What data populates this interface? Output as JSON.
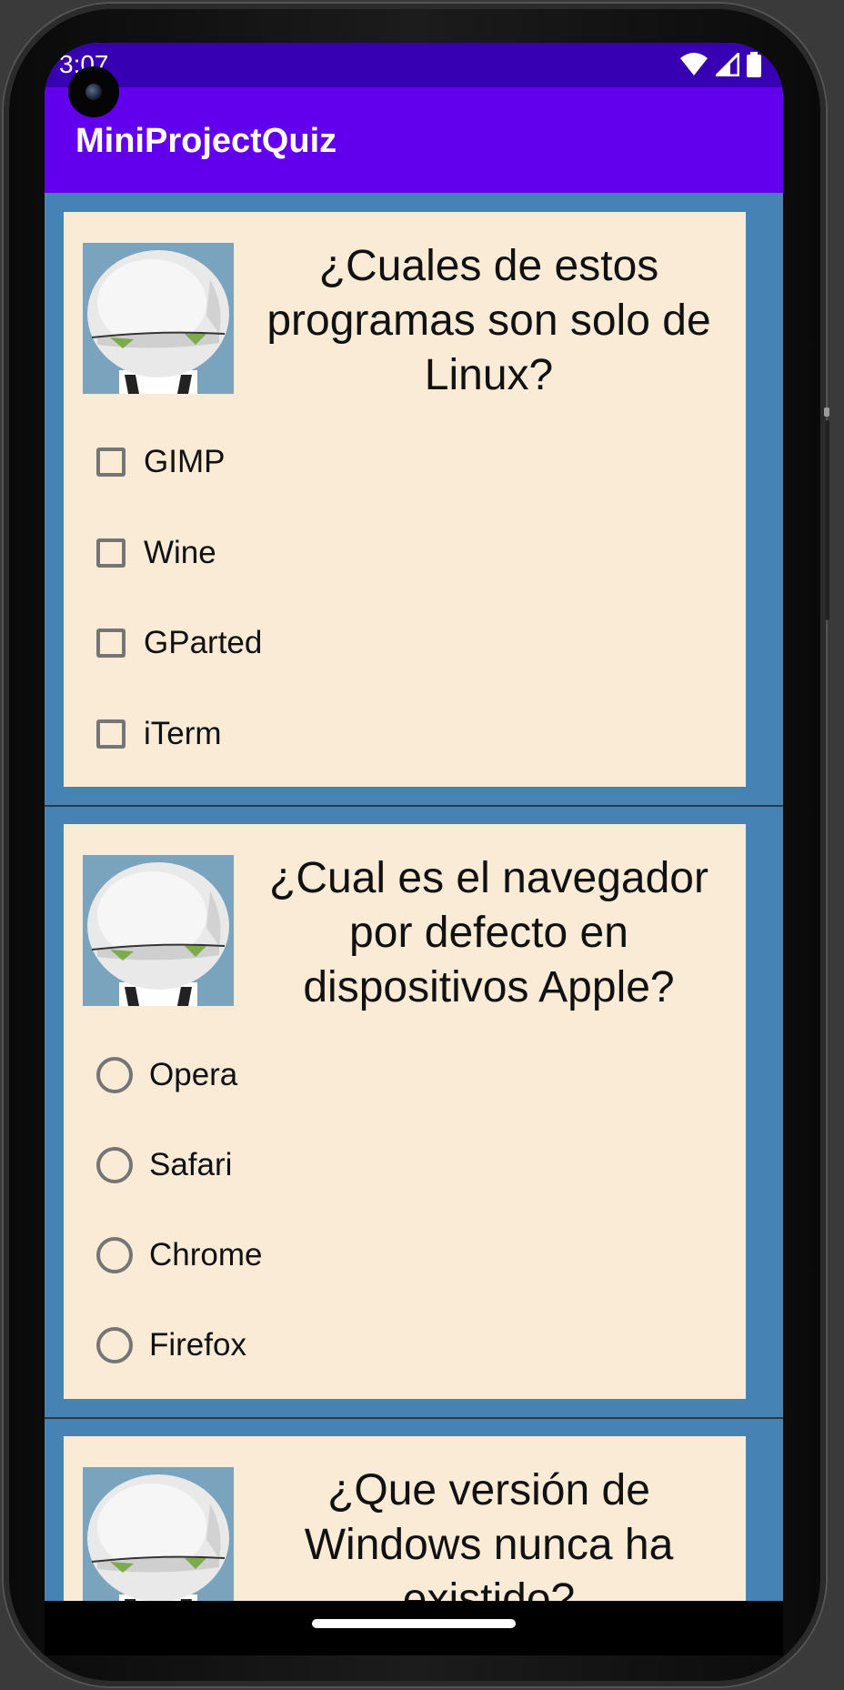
{
  "status_bar": {
    "time": "3:07"
  },
  "app_bar": {
    "title": "MiniProjectQuiz"
  },
  "questions": [
    {
      "type": "checkbox",
      "text": "¿Cuales de estos programas son solo de Linux?",
      "options": [
        "GIMP",
        "Wine",
        "GParted",
        "iTerm"
      ]
    },
    {
      "type": "radio",
      "text": "¿Cual es el navegador por defecto en dispositivos Apple?",
      "options": [
        "Opera",
        "Safari",
        "Chrome",
        "Firefox"
      ]
    },
    {
      "type": "unknown",
      "text": "¿Que versión de Windows nunca ha existido?",
      "options": []
    }
  ],
  "colors": {
    "status_bar": "#3700b3",
    "app_bar": "#6200ee",
    "background": "#4682b4",
    "card": "#faebd7"
  }
}
